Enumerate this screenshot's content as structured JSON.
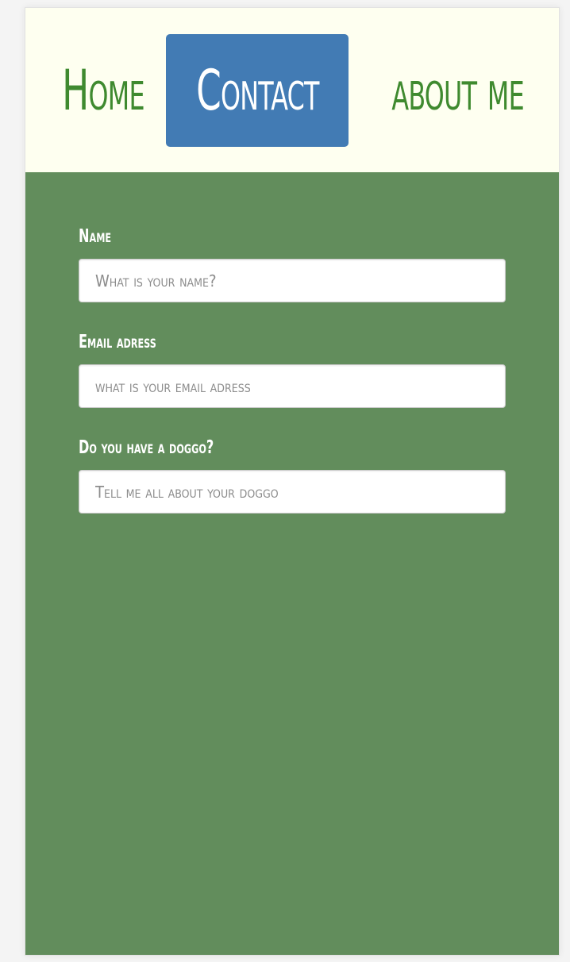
{
  "nav": {
    "home_label": "Home",
    "contact_label": "Contact",
    "about_label": "about me"
  },
  "form": {
    "name": {
      "label": "Name",
      "placeholder": "What is your name?"
    },
    "email": {
      "label": "Email adress",
      "placeholder": "what is your email adress"
    },
    "doggo": {
      "label": "Do you have a doggo?",
      "placeholder": "Tell me all about your doggo"
    }
  },
  "colors": {
    "navbar_bg": "#fefff0",
    "nav_text": "#3f8a2f",
    "active_tab_bg": "#427bb4",
    "page_bg": "#628d5c",
    "label_text": "#ffffff"
  }
}
